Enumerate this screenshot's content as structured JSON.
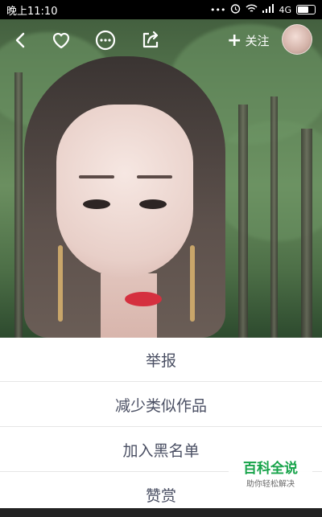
{
  "status_bar": {
    "time": "晚上11:10",
    "network": "4G",
    "icons": [
      "dots-icon",
      "alarm-icon",
      "wifi-icon",
      "signal-icon",
      "battery-icon"
    ]
  },
  "top_bar": {
    "icons": [
      "back-icon",
      "heart-icon",
      "more-icon",
      "share-icon"
    ],
    "follow_label": "关注",
    "follow_icon": "plus-icon"
  },
  "action_sheet": {
    "items": [
      {
        "label": "举报"
      },
      {
        "label": "减少类似作品"
      },
      {
        "label": "加入黑名单"
      },
      {
        "label": "赞赏"
      }
    ]
  },
  "watermark": {
    "title": "百科全说",
    "subtitle": "助你轻松解决"
  }
}
